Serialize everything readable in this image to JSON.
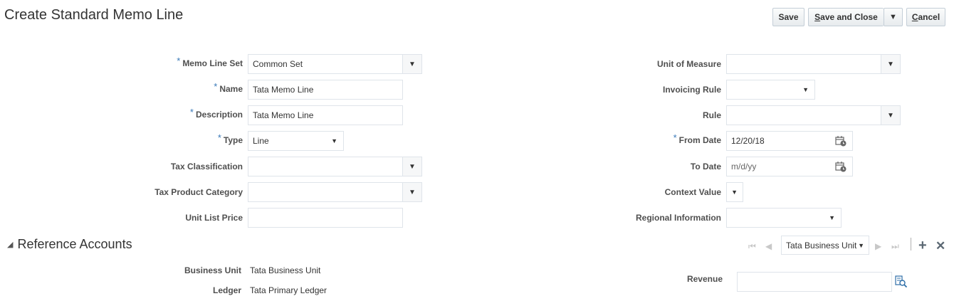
{
  "header": {
    "title": "Create Standard Memo Line",
    "save_label": "Save",
    "save_close_label": "Save and Close",
    "save_close_mnemonic": "S",
    "save_close_rest": "ave and Close",
    "cancel_mnemonic": "C",
    "cancel_rest": "ancel",
    "cancel_label": "Cancel"
  },
  "form": {
    "memo_line_set": {
      "label": "Memo Line Set",
      "value": "Common Set",
      "required": true
    },
    "name": {
      "label": "Name",
      "value": "Tata Memo Line",
      "required": true
    },
    "description": {
      "label": "Description",
      "value": "Tata Memo Line",
      "required": true
    },
    "type": {
      "label": "Type",
      "value": "Line",
      "required": true
    },
    "tax_classification": {
      "label": "Tax Classification",
      "value": ""
    },
    "tax_product_category": {
      "label": "Tax Product Category",
      "value": ""
    },
    "unit_list_price": {
      "label": "Unit List Price",
      "value": ""
    },
    "unit_of_measure": {
      "label": "Unit of Measure",
      "value": ""
    },
    "invoicing_rule": {
      "label": "Invoicing Rule",
      "value": ""
    },
    "rule": {
      "label": "Rule",
      "value": ""
    },
    "from_date": {
      "label": "From Date",
      "value": "12/20/18",
      "required": true
    },
    "to_date": {
      "label": "To Date",
      "value": "",
      "placeholder": "m/d/yy"
    },
    "context_value": {
      "label": "Context Value",
      "value": ""
    },
    "regional_information": {
      "label": "Regional Information",
      "value": ""
    }
  },
  "required_mark": "*",
  "reference_accounts": {
    "title": "Reference Accounts",
    "business_unit_selector": "Tata Business Unit",
    "business_unit": {
      "label": "Business Unit",
      "value": "Tata Business Unit"
    },
    "ledger": {
      "label": "Ledger",
      "value": "Tata Primary Ledger"
    },
    "revenue": {
      "label": "Revenue",
      "value": ""
    }
  },
  "icons": {
    "dropdown": "▼",
    "caret": "▼",
    "collapse": "◢",
    "first": "⏮",
    "prev": "◀",
    "next": "▶",
    "last": "⏭",
    "add": "+",
    "remove": "✕"
  }
}
